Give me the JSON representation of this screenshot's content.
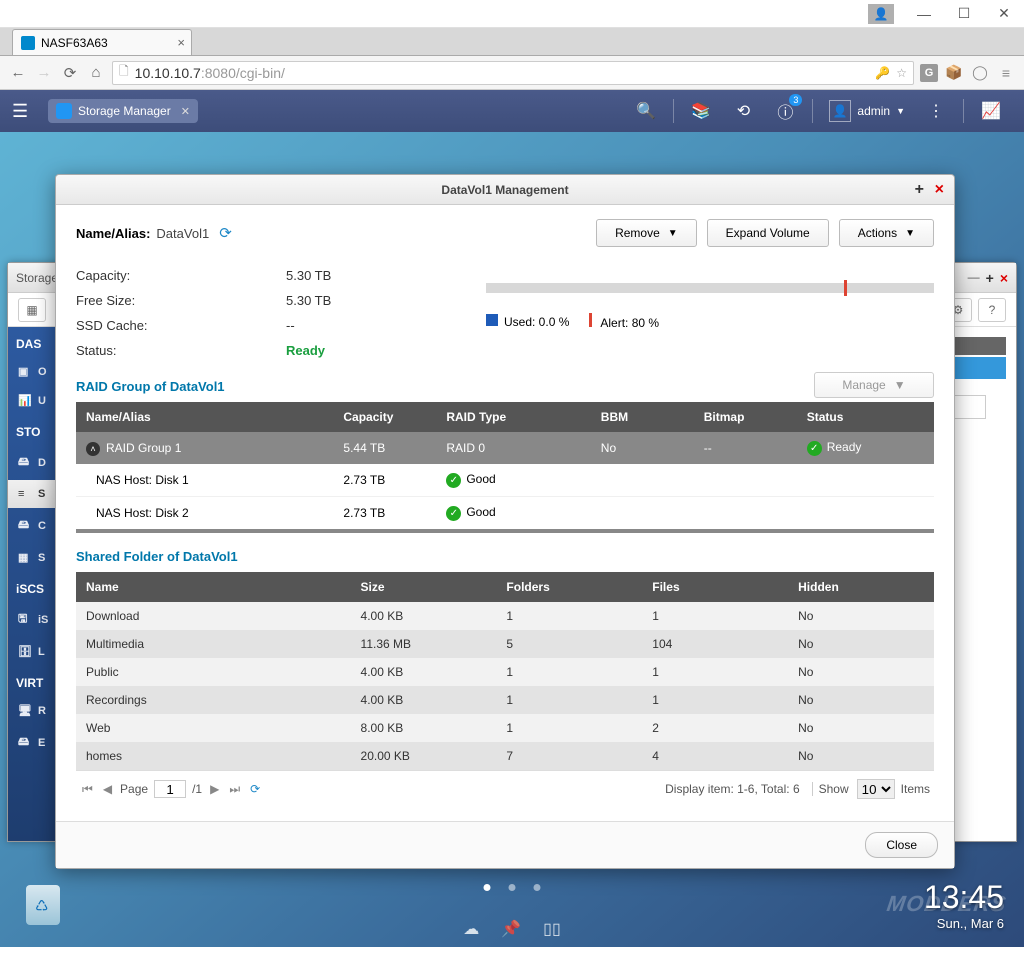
{
  "browser": {
    "tab_title": "NASF63A63",
    "url_host": "10.10.10.7",
    "url_rest": ":8080/cgi-bin/"
  },
  "qnap_header": {
    "app_tab": "Storage Manager",
    "badge": "3",
    "user": "admin"
  },
  "back_window": {
    "title": "Storage I"
  },
  "sidebar": {
    "cat1": "DAS",
    "i1": "O",
    "i2": "U",
    "cat2": "STO",
    "i3": "D",
    "i4": "S",
    "i5": "C",
    "i6": "S",
    "cat3": "iSCS",
    "i7": "iS",
    "i8": "L",
    "cat4": "VIRT",
    "i9": "R",
    "i10": "E"
  },
  "modal": {
    "title": "DataVol1 Management",
    "alias_label": "Name/Alias:",
    "alias_value": "DataVol1",
    "remove": "Remove",
    "expand": "Expand Volume",
    "actions": "Actions",
    "capacity_k": "Capacity:",
    "capacity_v": "5.30 TB",
    "free_k": "Free Size:",
    "free_v": "5.30 TB",
    "ssd_k": "SSD Cache:",
    "ssd_v": "--",
    "status_k": "Status:",
    "status_v": "Ready",
    "used_label": "Used: 0.0 %",
    "alert_label": "Alert: 80 %",
    "raid_title": "RAID Group of DataVol1",
    "manage": "Manage",
    "raid_headers": {
      "name": "Name/Alias",
      "cap": "Capacity",
      "type": "RAID Type",
      "bbm": "BBM",
      "bitmap": "Bitmap",
      "status": "Status"
    },
    "raid_group": {
      "name": "RAID Group 1",
      "cap": "5.44 TB",
      "type": "RAID 0",
      "bbm": "No",
      "bitmap": "--",
      "status": "Ready"
    },
    "disks": [
      {
        "name": "NAS Host: Disk 1",
        "cap": "2.73 TB",
        "status": "Good"
      },
      {
        "name": "NAS Host: Disk 2",
        "cap": "2.73 TB",
        "status": "Good"
      }
    ],
    "sf_title": "Shared Folder of DataVol1",
    "sf_headers": {
      "name": "Name",
      "size": "Size",
      "folders": "Folders",
      "files": "Files",
      "hidden": "Hidden"
    },
    "folders": [
      {
        "name": "Download",
        "size": "4.00 KB",
        "folders": "1",
        "files": "1",
        "hidden": "No"
      },
      {
        "name": "Multimedia",
        "size": "11.36 MB",
        "folders": "5",
        "files": "104",
        "hidden": "No"
      },
      {
        "name": "Public",
        "size": "4.00 KB",
        "folders": "1",
        "files": "1",
        "hidden": "No"
      },
      {
        "name": "Recordings",
        "size": "4.00 KB",
        "folders": "1",
        "files": "1",
        "hidden": "No"
      },
      {
        "name": "Web",
        "size": "8.00 KB",
        "folders": "1",
        "files": "2",
        "hidden": "No"
      },
      {
        "name": "homes",
        "size": "20.00 KB",
        "folders": "7",
        "files": "4",
        "hidden": "No"
      }
    ],
    "pager": {
      "page_label": "Page",
      "page": "1",
      "total": "/1",
      "display": "Display item: 1-6, Total: 6",
      "show": "Show",
      "per": "10",
      "items": "Items"
    },
    "close": "Close"
  },
  "clock": {
    "time": "13:45",
    "date": "Sun., Mar 6"
  },
  "watermark": "MODDERS"
}
